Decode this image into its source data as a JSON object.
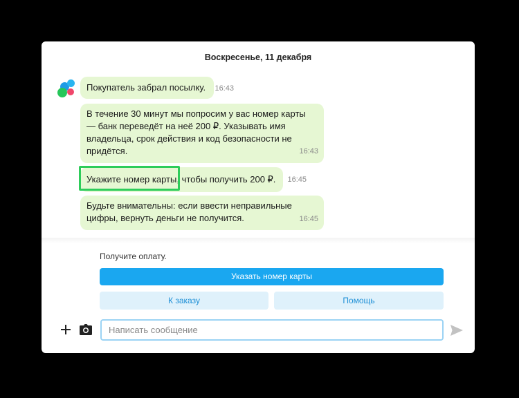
{
  "chat": {
    "date_header": "Воскресенье, 11 декабря",
    "avatar_icon": "app-logo-dots-icon",
    "messages": [
      {
        "text": "Покупатель забрал посылку.",
        "time": "16:43"
      },
      {
        "text": "В течение 30 минут мы попросим у вас номер карты — банк переведёт на неё 200 ₽. Указывать имя владельца, срок действия и код безопасности не придётся.",
        "time": "16:43"
      },
      {
        "text": "Укажите номер карты, чтобы получить 200 ₽.",
        "time": "16:45"
      },
      {
        "text": "Будьте внимательны: если ввести неправильные цифры, вернуть деньги не получится.",
        "time": "16:45"
      }
    ]
  },
  "actions": {
    "prompt": "Получите оплату.",
    "primary_button": "Указать номер карты",
    "order_button": "К заказу",
    "help_button": "Помощь"
  },
  "composer": {
    "placeholder": "Написать сообщение",
    "attach_icon": "plus-icon",
    "camera_icon": "camera-icon",
    "send_icon": "send-icon"
  },
  "colors": {
    "background": "#000000",
    "bubble": "#e6f7d3",
    "primary": "#1aa7f0",
    "secondary_bg": "#dff1fb",
    "highlight": "#2ecc5a",
    "input_border": "#9bd3f4"
  }
}
